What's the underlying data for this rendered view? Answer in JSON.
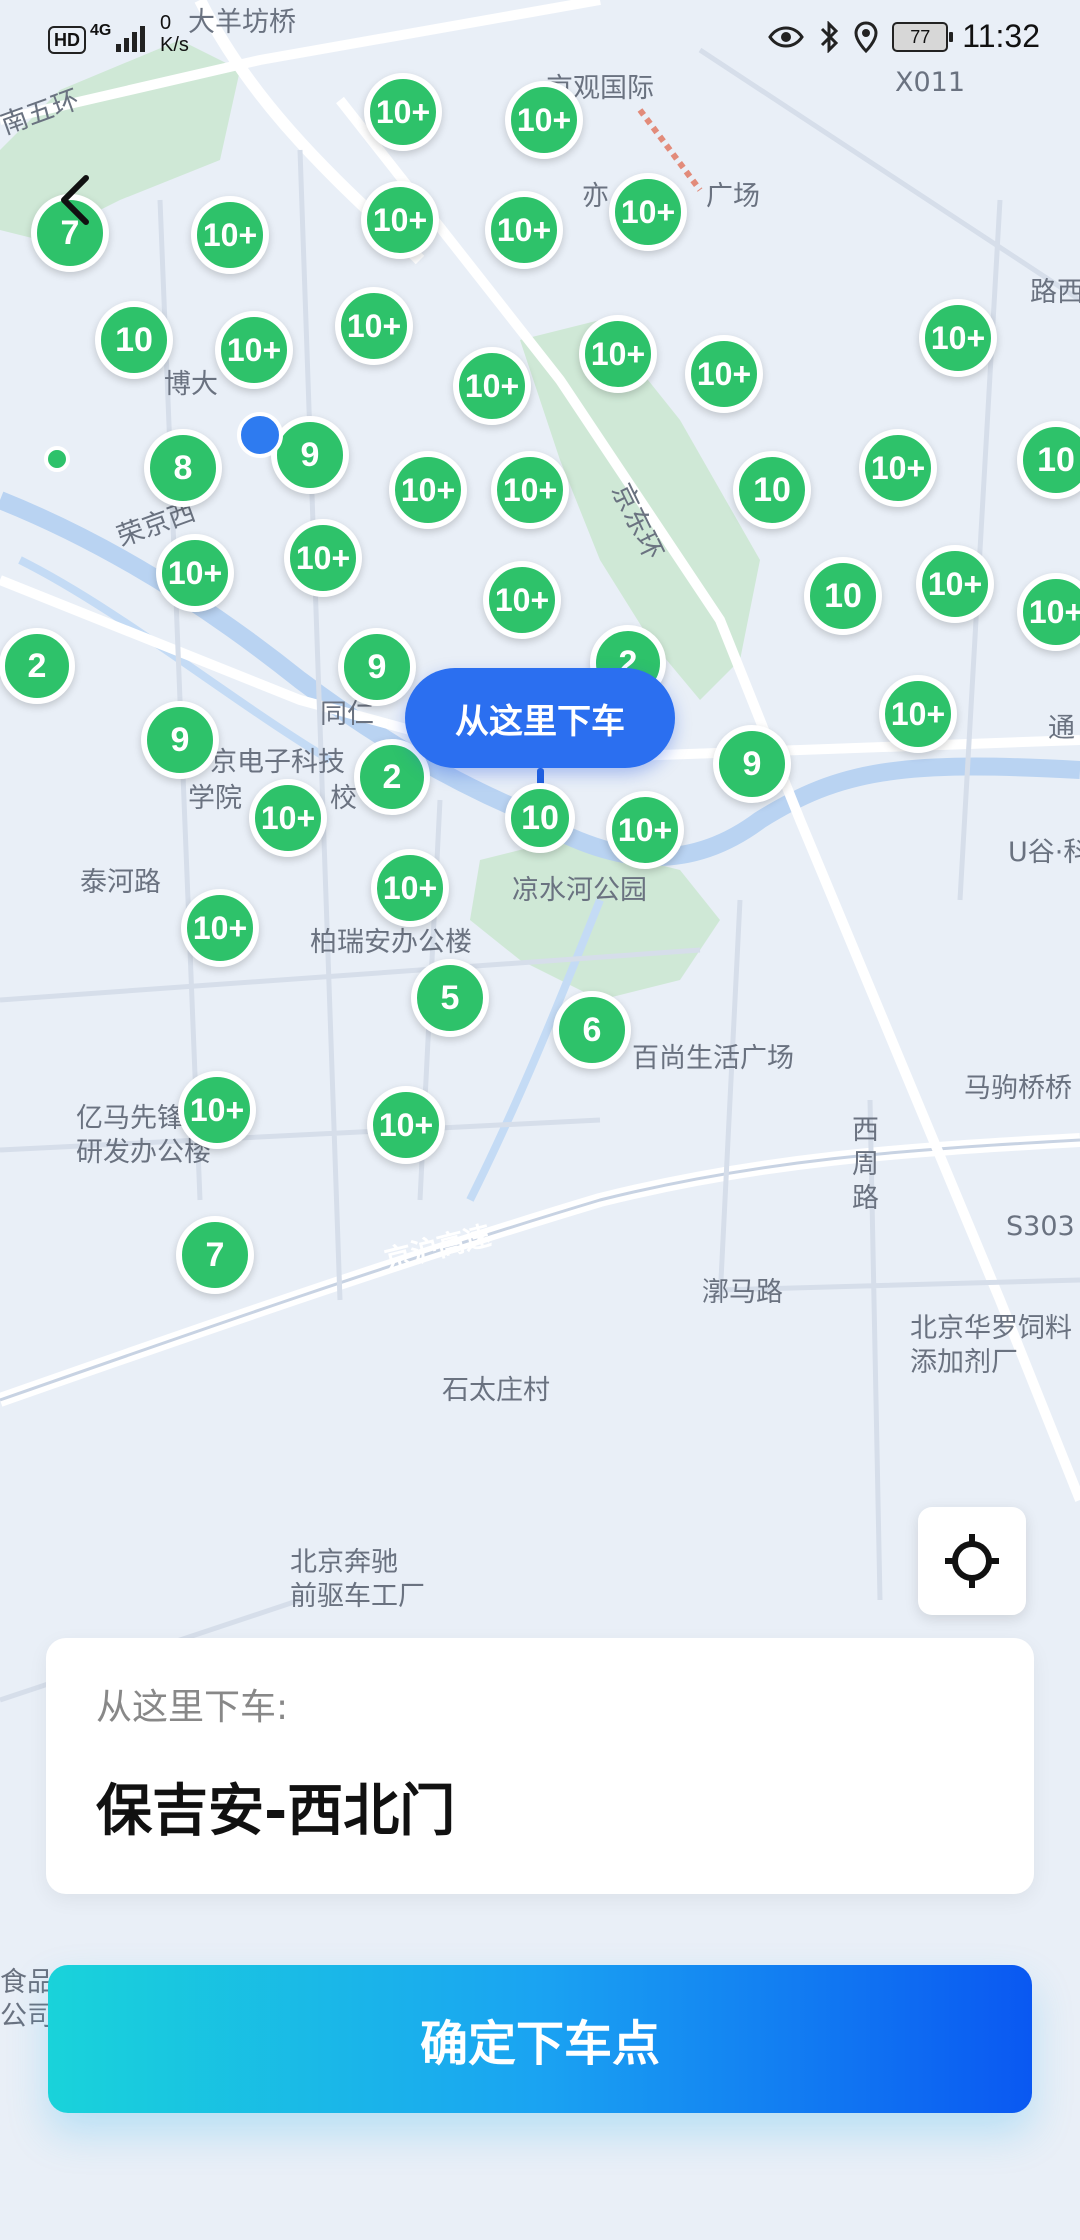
{
  "status_bar": {
    "hd": "HD",
    "network": "4G",
    "speed_value": "0",
    "speed_unit": "K/s",
    "battery": "77",
    "time": "11:32"
  },
  "map": {
    "labels": [
      {
        "text": "大羊坊桥",
        "name": "map-label-dayangfangqiao"
      },
      {
        "text": "南五环",
        "name": "map-label-nanwuhuan"
      },
      {
        "text": "京观国际",
        "name": "map-label-jingguanguoji"
      },
      {
        "text": "X011",
        "name": "map-label-x011"
      },
      {
        "text": "亦",
        "name": "map-label-yi"
      },
      {
        "text": "广场",
        "name": "map-label-guangchang"
      },
      {
        "text": "路西",
        "name": "map-label-luxi"
      },
      {
        "text": "博大",
        "name": "map-label-boda"
      },
      {
        "text": "荣京西",
        "name": "map-label-rongjingxi"
      },
      {
        "text": "京东环",
        "name": "map-label-jingdonghuan"
      },
      {
        "text": "同仁",
        "name": "map-label-tongren"
      },
      {
        "text": "京电子科技",
        "name": "map-label-dianzikeji"
      },
      {
        "text": "学院",
        "name": "map-label-xueyuan"
      },
      {
        "text": "校",
        "name": "map-label-xiao"
      },
      {
        "text": "通",
        "name": "map-label-tong"
      },
      {
        "text": "U谷·科",
        "name": "map-label-ugu"
      },
      {
        "text": "泰河路",
        "name": "map-label-taihelu"
      },
      {
        "text": "凉水河公园",
        "name": "map-label-liangshuihe-park"
      },
      {
        "text": "柏瑞安办公楼",
        "name": "map-label-bairuian"
      },
      {
        "text": "百尚生活广场",
        "name": "map-label-baishang"
      },
      {
        "text": "马驹桥桥",
        "name": "map-label-majuqiao"
      },
      {
        "text": "亿马先锋\n研发办公楼",
        "name": "map-label-yima"
      },
      {
        "text": "西\n周\n路",
        "name": "map-label-xizhoulu"
      },
      {
        "text": "S303",
        "name": "map-label-s303"
      },
      {
        "text": "京沪高速",
        "name": "map-label-jinghu"
      },
      {
        "text": "漷马路",
        "name": "map-label-huomalu"
      },
      {
        "text": "北京华罗饲料\n添加剂厂",
        "name": "map-label-hualuo"
      },
      {
        "text": "石太庄村",
        "name": "map-label-shitaizhuang"
      },
      {
        "text": "北京奔驰\n前驱车工厂",
        "name": "map-label-benchi"
      },
      {
        "text": "食品\n公司",
        "name": "map-label-shipin"
      }
    ],
    "clusters": [
      "10+",
      "10+",
      "7",
      "10+",
      "10+",
      "10+",
      "10+",
      "10",
      "10+",
      "10+",
      "10+",
      "10+",
      "10+",
      "10+",
      "8",
      "9",
      "10+",
      "10+",
      "10",
      "10+",
      "10",
      "10+",
      "10+",
      "10+",
      "10",
      "10+",
      "10+",
      "2",
      "9",
      "9",
      "2",
      "10+",
      "9",
      "10+",
      "10+",
      "10+",
      "10+",
      "10+",
      "5",
      "6",
      "10+",
      "7",
      "2",
      "10"
    ]
  },
  "drop_tooltip": "从这里下车",
  "pin_count": "9",
  "card": {
    "label": "从这里下车:",
    "place": "保吉安-西北门"
  },
  "confirm_button": "确定下车点",
  "colors": {
    "cluster_green": "#2ec26a",
    "tooltip_blue": "#2b6ff0",
    "button_gradient_start": "#19d3da",
    "button_gradient_end": "#0a58f2"
  }
}
